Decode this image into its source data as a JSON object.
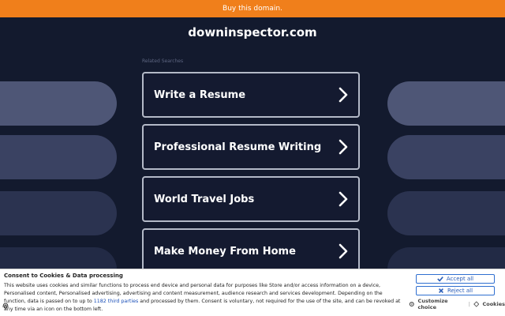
{
  "topbar": {
    "buy_label": "Buy this domain."
  },
  "header": {
    "domain": "downinspector.com"
  },
  "related": {
    "label": "Related Searches",
    "items": [
      {
        "label": "Write a Resume"
      },
      {
        "label": "Professional Resume Writing"
      },
      {
        "label": "World Travel Jobs"
      },
      {
        "label": "Make Money From Home"
      }
    ]
  },
  "consent": {
    "title": "Consent to Cookies & Data processing",
    "text_before_link": "This website uses cookies and similar functions to process end device and personal data for purposes like Store and/or access information on a device, Personalised content, Personalised advertising, advertising and content measurement, audience research and services development. Depending on the function, data is passed on to up to ",
    "link_text": "1182 third parties",
    "text_after_link": " and processed by them. Consent is voluntary, not required for the use of the site, and can be revoked at any time via an icon on the bottom left.",
    "accept_label": "Accept all",
    "reject_label": "Reject all",
    "customize_label": "Customize choice",
    "separator": "|",
    "cookies_label": "Cookies"
  },
  "colors": {
    "background": "#131a2e",
    "topbar": "#f07f1b",
    "card_border": "#b3b9c7",
    "link": "#1a4fb8"
  }
}
